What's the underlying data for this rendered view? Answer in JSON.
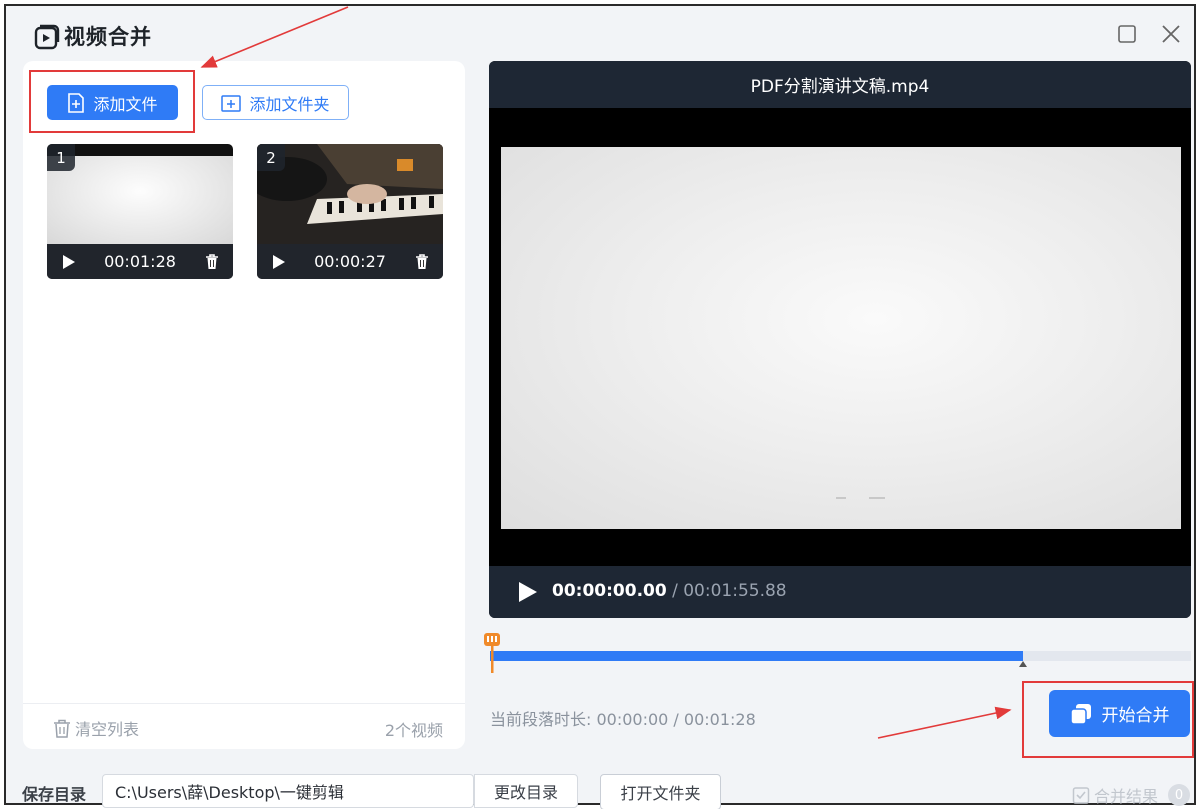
{
  "app": {
    "title": "视频合并",
    "icon": "video-play-icon",
    "window_controls": [
      "maximize-icon",
      "close-icon"
    ]
  },
  "toolbar": {
    "add_file_label": "添加文件",
    "add_folder_label": "添加文件夹"
  },
  "videos": [
    {
      "index": "1",
      "duration": "00:01:28"
    },
    {
      "index": "2",
      "duration": "00:00:27"
    }
  ],
  "list_footer": {
    "clear_label": "清空列表",
    "count_label": "2个视频"
  },
  "preview": {
    "file_name": "PDF分割演讲文稿.mp4",
    "current_time": "00:00:00.00",
    "separator": " / ",
    "total_time": "00:01:55.88"
  },
  "timeline": {
    "progress_fraction": 0.76
  },
  "segment": {
    "duration_text": "当前段落时长: 00:00:00 / 00:01:28"
  },
  "actions": {
    "start_merge_label": "开始合并"
  },
  "bottom": {
    "save_dir_label": "保存目录",
    "save_path": "C:\\Users\\薛\\Desktop\\一键剪辑",
    "change_dir_label": "更改目录",
    "open_folder_label": "打开文件夹",
    "merge_result_label": "合并结果",
    "merge_result_count": "0"
  },
  "colors": {
    "accent": "#2f7bf6",
    "annotation_red": "#e23a3a",
    "preview_bar": "#1e2734"
  }
}
